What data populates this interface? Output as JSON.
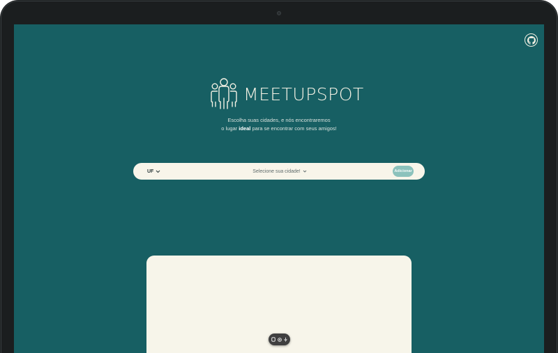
{
  "brand": {
    "title": "MEETUPSPOT",
    "icon": "people-group-icon"
  },
  "tagline": {
    "line1": "Escolha suas cidades, e nós encontraremos",
    "line2_before": "o lugar ",
    "line2_bold": "ideal",
    "line2_after": " para se encontrar com seus amigos!"
  },
  "search": {
    "uf_label": "UF",
    "city_placeholder": "Selecione sua cidade!",
    "add_label": "Adicionar"
  },
  "header": {
    "github_icon": "github-icon"
  },
  "controls": [
    "capture-icon",
    "record-icon",
    "microphone-icon"
  ],
  "colors": {
    "background": "#175f63",
    "surface": "#f7f5ea",
    "accent": "#8bc2bc",
    "text_light": "#f3f1e4",
    "bezel": "#1b1e1f"
  }
}
